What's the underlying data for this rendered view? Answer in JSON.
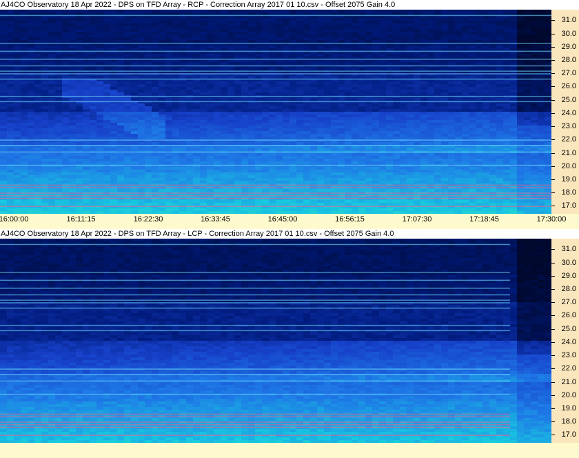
{
  "chart_data": [
    {
      "type": "heatmap",
      "title": "AJ4CO Observatory 18 Apr 2022  -  DPS on TFD Array  -  RCP  -  Correction Array 2017 01 10.csv  -  Offset 2075  Gain 4.0",
      "polarization": "RCP",
      "x_ticks": [
        "16:00:00",
        "16:11:15",
        "16:22:30",
        "16:33:45",
        "16:45:00",
        "16:56:15",
        "17:07:30",
        "17:18:45",
        "17:30:00"
      ],
      "y_ticks": [
        "31.0",
        "30.0",
        "29.0",
        "28.0",
        "27.0",
        "26.0",
        "25.0",
        "24.0",
        "23.0",
        "22.0",
        "21.0",
        "20.0",
        "19.0",
        "18.0",
        "17.0"
      ],
      "ylim": [
        16.4,
        31.8
      ],
      "xlabel": "",
      "ylabel": ""
    },
    {
      "type": "heatmap",
      "title": "AJ4CO Observatory 18 Apr 2022  -  DPS on TFD Array  -  LCP  -  Correction Array 2017 01 10.csv  -  Offset 2075  Gain 4.0",
      "polarization": "LCP",
      "x_ticks": [],
      "y_ticks": [
        "31.0",
        "30.0",
        "29.0",
        "28.0",
        "27.0",
        "26.0",
        "25.0",
        "24.0",
        "23.0",
        "22.0",
        "21.0",
        "20.0",
        "19.0",
        "18.0",
        "17.0"
      ],
      "ylim": [
        16.4,
        31.8
      ],
      "xlabel": "",
      "ylabel": ""
    }
  ],
  "colors": {
    "axis_bg": "#fae6bd",
    "time_axis_bg": "#fffacd",
    "colormap": [
      "#00082e",
      "#001a7a",
      "#1640c8",
      "#1e78e6",
      "#18c8e0",
      "#4ae8b4",
      "#c8f050",
      "#ff5a8c"
    ]
  }
}
